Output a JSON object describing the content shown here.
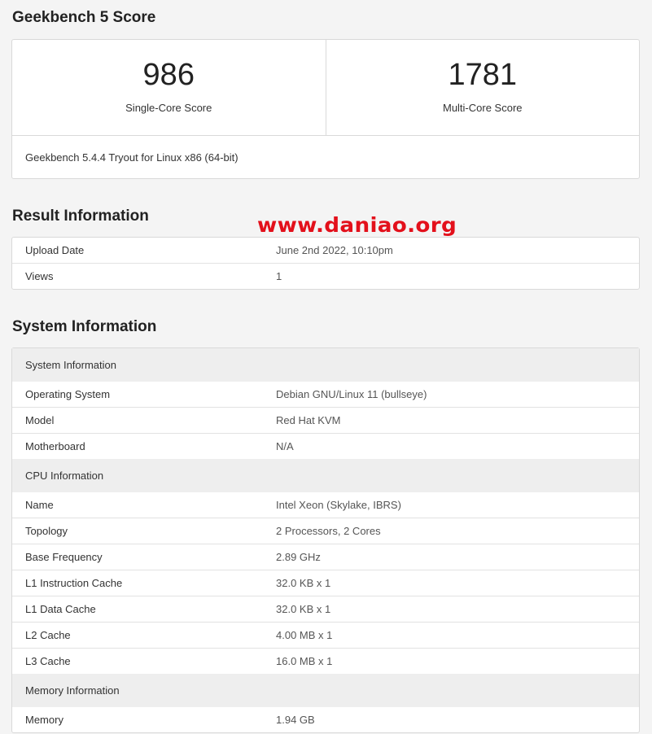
{
  "score_section": {
    "title": "Geekbench 5 Score",
    "single_core_value": "986",
    "single_core_label": "Single-Core Score",
    "multi_core_value": "1781",
    "multi_core_label": "Multi-Core Score",
    "footer": "Geekbench 5.4.4 Tryout for Linux x86 (64-bit)"
  },
  "result_section": {
    "title": "Result Information",
    "rows": [
      {
        "key": "Upload Date",
        "value": "June 2nd 2022, 10:10pm"
      },
      {
        "key": "Views",
        "value": "1"
      }
    ]
  },
  "watermark": "www.daniao.org",
  "system_section": {
    "title": "System Information",
    "groups": [
      {
        "header": "System Information",
        "rows": [
          {
            "key": "Operating System",
            "value": "Debian GNU/Linux 11 (bullseye)"
          },
          {
            "key": "Model",
            "value": "Red Hat KVM"
          },
          {
            "key": "Motherboard",
            "value": "N/A"
          }
        ]
      },
      {
        "header": "CPU Information",
        "rows": [
          {
            "key": "Name",
            "value": "Intel Xeon (Skylake, IBRS)"
          },
          {
            "key": "Topology",
            "value": "2 Processors, 2 Cores"
          },
          {
            "key": "Base Frequency",
            "value": "2.89 GHz"
          },
          {
            "key": "L1 Instruction Cache",
            "value": "32.0 KB x 1"
          },
          {
            "key": "L1 Data Cache",
            "value": "32.0 KB x 1"
          },
          {
            "key": "L2 Cache",
            "value": "4.00 MB x 1"
          },
          {
            "key": "L3 Cache",
            "value": "16.0 MB x 1"
          }
        ]
      },
      {
        "header": "Memory Information",
        "rows": [
          {
            "key": "Memory",
            "value": "1.94 GB"
          }
        ]
      }
    ]
  }
}
